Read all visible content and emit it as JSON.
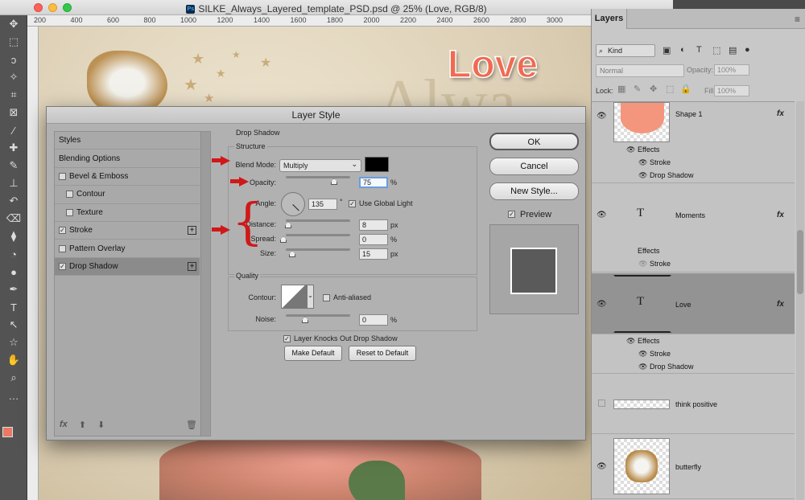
{
  "window": {
    "title": "SILKE_Always_Layered_template_PSD.psd @ 25% (Love, RGB/8)",
    "app_badge": "Ps"
  },
  "ruler": {
    "ticks": [
      "200",
      "400",
      "600",
      "800",
      "1000",
      "1200",
      "1400",
      "1600",
      "1800",
      "2000",
      "2200",
      "2400",
      "2600",
      "2800",
      "3000"
    ]
  },
  "canvas": {
    "love_text": "Love",
    "always_text": "Alwa"
  },
  "toolbar": {
    "tools": [
      "move-icon",
      "marquee-icon",
      "lasso-icon",
      "magic-wand-icon",
      "crop-icon",
      "frame-icon",
      "eyedropper-icon",
      "healing-icon",
      "brush-icon",
      "stamp-icon",
      "history-brush-icon",
      "eraser-icon",
      "paint-bucket-icon",
      "blur-icon",
      "dodge-icon",
      "pen-icon",
      "type-icon",
      "path-select-icon",
      "shape-icon",
      "hand-icon",
      "zoom-icon",
      "more-icon"
    ],
    "glyphs": [
      "✥",
      "⬚",
      "ↄ",
      "✧",
      "⌗",
      "⊠",
      "⁄",
      "✚",
      "✎",
      "⊥",
      "↶",
      "⌫",
      "⧫",
      "◔",
      "●",
      "✒",
      "T",
      "↖",
      "☆",
      "✋",
      "⌕",
      "…"
    ],
    "foreground_color": "#e87a64",
    "background_color": "#000000"
  },
  "dialog": {
    "title": "Layer Style",
    "styles_list": [
      {
        "label": "Styles",
        "checkbox": false,
        "checked": false,
        "indent": false,
        "plus": false,
        "selected": false
      },
      {
        "label": "Blending Options",
        "checkbox": false,
        "checked": false,
        "indent": false,
        "plus": false,
        "selected": false
      },
      {
        "label": "Bevel & Emboss",
        "checkbox": true,
        "checked": false,
        "indent": false,
        "plus": false,
        "selected": false
      },
      {
        "label": "Contour",
        "checkbox": true,
        "checked": false,
        "indent": true,
        "plus": false,
        "selected": false
      },
      {
        "label": "Texture",
        "checkbox": true,
        "checked": false,
        "indent": true,
        "plus": false,
        "selected": false
      },
      {
        "label": "Stroke",
        "checkbox": true,
        "checked": true,
        "indent": false,
        "plus": true,
        "selected": false
      },
      {
        "label": "Pattern Overlay",
        "checkbox": true,
        "checked": false,
        "indent": false,
        "plus": false,
        "selected": false
      },
      {
        "label": "Drop Shadow",
        "checkbox": true,
        "checked": true,
        "indent": false,
        "plus": true,
        "selected": true
      }
    ],
    "footer": {
      "fx": "fx",
      "up": "⬆",
      "down": "⬇",
      "trash": "🗑"
    },
    "drop_shadow": {
      "section_title": "Drop Shadow",
      "structure_title": "Structure",
      "blend_mode_label": "Blend Mode:",
      "blend_mode_value": "Multiply",
      "shadow_color": "#000000",
      "opacity_label": "Opacity:",
      "opacity_value": "75",
      "opacity_unit": "%",
      "angle_label": "Angle:",
      "angle_value": "135",
      "angle_unit": "°",
      "use_global_light_label": "Use Global Light",
      "use_global_light_checked": true,
      "distance_label": "Distance:",
      "distance_value": "8",
      "distance_unit": "px",
      "spread_label": "Spread:",
      "spread_value": "0",
      "spread_unit": "%",
      "size_label": "Size:",
      "size_value": "15",
      "size_unit": "px",
      "quality_title": "Quality",
      "contour_label": "Contour:",
      "anti_aliased_label": "Anti-aliased",
      "anti_aliased_checked": false,
      "noise_label": "Noise:",
      "noise_value": "0",
      "noise_unit": "%",
      "knocks_out_label": "Layer Knocks Out Drop Shadow",
      "knocks_out_checked": true,
      "make_default_label": "Make Default",
      "reset_default_label": "Reset to Default"
    },
    "buttons": {
      "ok": "OK",
      "cancel": "Cancel",
      "new_style": "New Style...",
      "preview_label": "Preview",
      "preview_checked": true
    },
    "annotation_color": "#d01818"
  },
  "layers_panel": {
    "tab": "Layers",
    "filter_kind": "Kind",
    "blend_mode": "Normal",
    "opacity_label": "Opacity:",
    "opacity_value": "100%",
    "lock_label": "Lock:",
    "fill_label": "Fill:",
    "fill_value": "100%",
    "layers": [
      {
        "name": "Shape 1",
        "fx": "fx",
        "effects": [
          "Effects",
          "Stroke",
          "Drop Shadow"
        ]
      },
      {
        "name": "Moments",
        "fx": "fx",
        "thumb_glyph": "T",
        "effects": [
          "Effects",
          "Stroke"
        ]
      },
      {
        "name": "Love",
        "fx": "fx",
        "thumb_glyph": "T",
        "selected": true,
        "effects": [
          "Effects",
          "Stroke",
          "Drop Shadow"
        ]
      },
      {
        "name": "think positive"
      },
      {
        "name": "butterfly"
      }
    ],
    "colors": {
      "shape_fill": "#f4967e",
      "selected_row": "#939393"
    }
  }
}
